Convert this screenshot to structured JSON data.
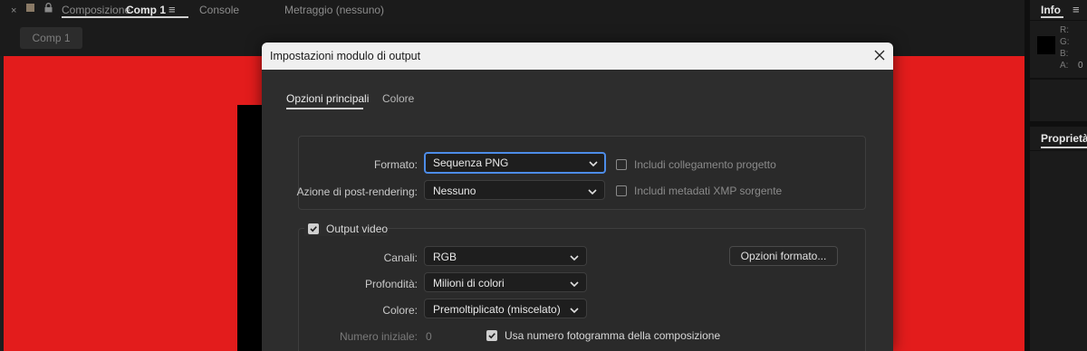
{
  "composition_panel": {
    "close_glyph": "×",
    "title": "Composizione",
    "comp_name": "Comp 1",
    "menu_glyph": "≡",
    "tabs": [
      "Console",
      "Metraggio (nessuno)"
    ],
    "breadcrumb_chip": "Comp 1",
    "canvas_color": "#e31c1c",
    "layer_color": "#000000"
  },
  "info_panel": {
    "title": "Info",
    "menu_glyph": "≡",
    "channels": [
      "R:",
      "G:",
      "B:",
      "A:"
    ],
    "alpha_value": "0"
  },
  "properties_panel": {
    "title": "Proprietà:"
  },
  "dialog": {
    "title": "Impostazioni modulo di output",
    "tabs": [
      {
        "label": "Opzioni principali",
        "active": true
      },
      {
        "label": "Colore",
        "active": false
      }
    ],
    "main": {
      "format_label": "Formato:",
      "format_value": "Sequenza PNG",
      "post_render_label": "Azione di post-rendering:",
      "post_render_value": "Nessuno",
      "include_project_link": {
        "label": "Includi collegamento progetto",
        "checked": false
      },
      "include_xmp": {
        "label": "Includi metadati XMP sorgente",
        "checked": false
      }
    },
    "video_output": {
      "label": "Output video",
      "checked": true,
      "channels_label": "Canali:",
      "channels_value": "RGB",
      "depth_label": "Profondità:",
      "depth_value": "Milioni di colori",
      "color_label": "Colore:",
      "color_value": "Premoltiplicato (miscelato)",
      "start_number_label": "Numero iniziale:",
      "start_number_value": "0",
      "use_comp_frame": {
        "label": "Usa numero fotogramma della composizione",
        "checked": true
      },
      "format_options_button": "Opzioni formato..."
    }
  },
  "colors": {
    "accent": "#4d8ce8",
    "dialog_bg": "#2d2d2d",
    "titlebar_bg": "#f0f0f0"
  }
}
